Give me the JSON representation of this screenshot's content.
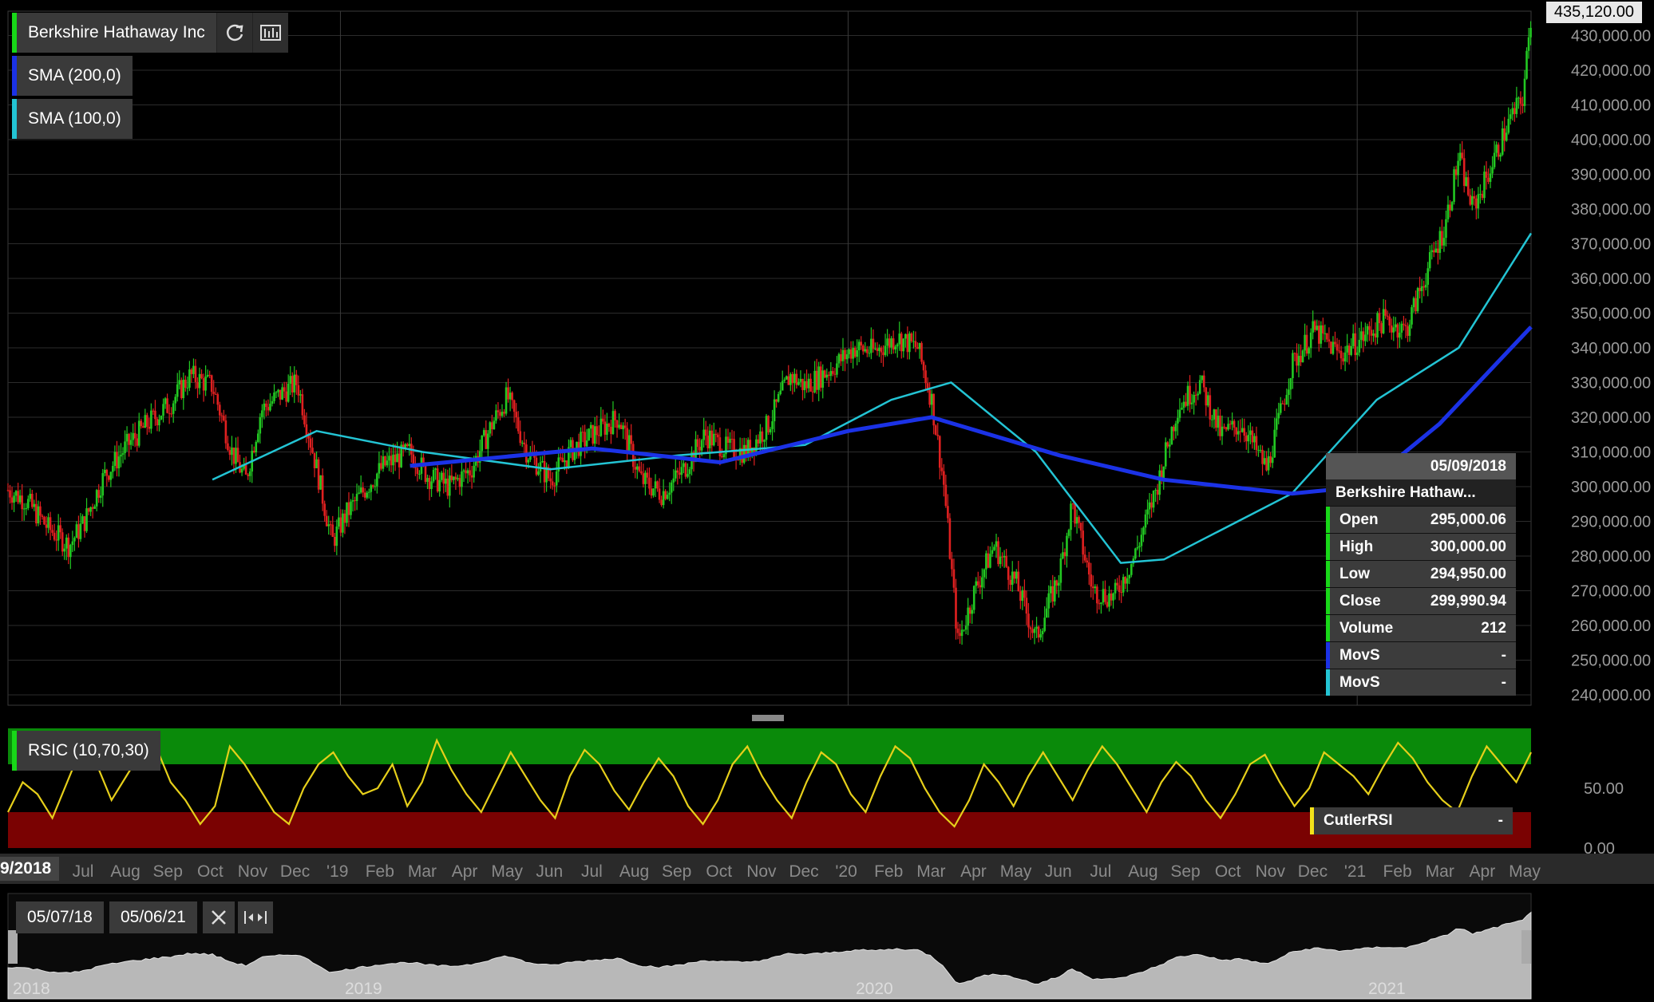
{
  "header": {
    "symbol_label": "Berkshire Hathaway Inc",
    "refresh_icon": "refresh-icon",
    "chart_settings_icon": "chart-settings-icon",
    "current_price_flag": "435,120.00"
  },
  "legend": [
    {
      "label": "SMA (200,0)",
      "color": "#1b32e6"
    },
    {
      "label": "SMA (100,0)",
      "color": "#23c4d4"
    }
  ],
  "colors": {
    "up": "#22c822",
    "down": "#e02020",
    "symbol_marker": "#18d818",
    "sma200": "#1b32e6",
    "sma100": "#23c4d4",
    "rsi_line": "#e6cf1a",
    "rsi_upper_zone": "#0a8a0a",
    "rsi_lower_zone": "#7a0202"
  },
  "tooltip": {
    "date": "05/09/2018",
    "name": "Berkshire Hathaw...",
    "rows": [
      {
        "key": "Open",
        "value": "295,000.06",
        "color": "#18d818"
      },
      {
        "key": "High",
        "value": "300,000.00",
        "color": "#18d818"
      },
      {
        "key": "Low",
        "value": "294,950.00",
        "color": "#18d818"
      },
      {
        "key": "Close",
        "value": "299,990.94",
        "color": "#18d818"
      },
      {
        "key": "Volume",
        "value": "212",
        "color": "#18d818"
      },
      {
        "key": "MovS",
        "value": "-",
        "color": "#1b32e6"
      },
      {
        "key": "MovS",
        "value": "-",
        "color": "#23c4d4"
      }
    ]
  },
  "rsi_panel": {
    "label": "RSIC (10,70,30)",
    "indicator_name": "CutlerRSI",
    "indicator_value": "-",
    "y_ticks": [
      "50.00",
      "0.00"
    ]
  },
  "time_axis": {
    "start_flag": "9/2018",
    "labels": [
      "Jul",
      "Aug",
      "Sep",
      "Oct",
      "Nov",
      "Dec",
      "'19",
      "Feb",
      "Mar",
      "Apr",
      "May",
      "Jun",
      "Jul",
      "Aug",
      "Sep",
      "Oct",
      "Nov",
      "Dec",
      "'20",
      "Feb",
      "Mar",
      "Apr",
      "May",
      "Jun",
      "Jul",
      "Aug",
      "Sep",
      "Oct",
      "Nov",
      "Dec",
      "'21",
      "Feb",
      "Mar",
      "Apr",
      "May"
    ]
  },
  "navigator": {
    "from_date": "05/07/18",
    "to_date": "05/06/21",
    "close_icon": "close-icon",
    "fit-range_icon": "fit-range-icon",
    "year_labels": [
      "2018",
      "2019",
      "2020",
      "2021"
    ]
  },
  "chart_data": {
    "type": "candlestick",
    "title": "Berkshire Hathaway Inc",
    "y_ticks": [
      "430,000.00",
      "420,000.00",
      "410,000.00",
      "400,000.00",
      "390,000.00",
      "380,000.00",
      "370,000.00",
      "360,000.00",
      "350,000.00",
      "340,000.00",
      "330,000.00",
      "320,000.00",
      "310,000.00",
      "300,000.00",
      "290,000.00",
      "280,000.00",
      "270,000.00",
      "260,000.00",
      "250,000.00",
      "240,000.00"
    ],
    "ylim": [
      237000,
      437000
    ],
    "grid": true,
    "close_series": {
      "name": "Berkshire Hathaway Inc",
      "points": [
        [
          "2018-05-07",
          299000
        ],
        [
          "2018-05-20",
          296000
        ],
        [
          "2018-06-05",
          288000
        ],
        [
          "2018-06-20",
          283000
        ],
        [
          "2018-07-01",
          290000
        ],
        [
          "2018-07-15",
          303000
        ],
        [
          "2018-08-01",
          312000
        ],
        [
          "2018-08-15",
          318000
        ],
        [
          "2018-09-01",
          324000
        ],
        [
          "2018-09-15",
          332000
        ],
        [
          "2018-10-01",
          329000
        ],
        [
          "2018-10-15",
          310000
        ],
        [
          "2018-10-25",
          302000
        ],
        [
          "2018-11-05",
          322000
        ],
        [
          "2018-11-20",
          327000
        ],
        [
          "2018-12-01",
          330000
        ],
        [
          "2018-12-15",
          305000
        ],
        [
          "2018-12-26",
          284000
        ],
        [
          "2019-01-05",
          292000
        ],
        [
          "2019-01-20",
          300000
        ],
        [
          "2019-02-01",
          306000
        ],
        [
          "2019-02-20",
          310000
        ],
        [
          "2019-03-05",
          303000
        ],
        [
          "2019-03-20",
          300000
        ],
        [
          "2019-04-05",
          305000
        ],
        [
          "2019-04-20",
          318000
        ],
        [
          "2019-05-01",
          326000
        ],
        [
          "2019-05-15",
          310000
        ],
        [
          "2019-06-01",
          302000
        ],
        [
          "2019-06-15",
          310000
        ],
        [
          "2019-07-01",
          315000
        ],
        [
          "2019-07-20",
          320000
        ],
        [
          "2019-08-05",
          302000
        ],
        [
          "2019-08-20",
          298000
        ],
        [
          "2019-09-05",
          305000
        ],
        [
          "2019-09-20",
          315000
        ],
        [
          "2019-10-05",
          311000
        ],
        [
          "2019-10-20",
          310000
        ],
        [
          "2019-11-05",
          318000
        ],
        [
          "2019-11-20",
          332000
        ],
        [
          "2019-12-01",
          329000
        ],
        [
          "2019-12-20",
          334000
        ],
        [
          "2020-01-05",
          340000
        ],
        [
          "2020-01-20",
          339000
        ],
        [
          "2020-02-05",
          343000
        ],
        [
          "2020-02-20",
          340000
        ],
        [
          "2020-03-01",
          325000
        ],
        [
          "2020-03-10",
          300000
        ],
        [
          "2020-03-20",
          255000
        ],
        [
          "2020-04-01",
          270000
        ],
        [
          "2020-04-15",
          283000
        ],
        [
          "2020-05-01",
          272000
        ],
        [
          "2020-05-15",
          256000
        ],
        [
          "2020-06-01",
          275000
        ],
        [
          "2020-06-10",
          295000
        ],
        [
          "2020-06-25",
          270000
        ],
        [
          "2020-07-10",
          268000
        ],
        [
          "2020-07-25",
          280000
        ],
        [
          "2020-08-10",
          300000
        ],
        [
          "2020-08-25",
          323000
        ],
        [
          "2020-09-10",
          330000
        ],
        [
          "2020-09-25",
          315000
        ],
        [
          "2020-10-10",
          318000
        ],
        [
          "2020-10-28",
          305000
        ],
        [
          "2020-11-05",
          318000
        ],
        [
          "2020-11-15",
          335000
        ],
        [
          "2020-12-01",
          345000
        ],
        [
          "2020-12-20",
          338000
        ],
        [
          "2021-01-05",
          343000
        ],
        [
          "2021-01-20",
          348000
        ],
        [
          "2021-02-05",
          345000
        ],
        [
          "2021-02-20",
          362000
        ],
        [
          "2021-03-05",
          375000
        ],
        [
          "2021-03-15",
          395000
        ],
        [
          "2021-03-25",
          380000
        ],
        [
          "2021-04-05",
          390000
        ],
        [
          "2021-04-20",
          405000
        ],
        [
          "2021-04-30",
          412000
        ],
        [
          "2021-05-06",
          435120
        ]
      ]
    },
    "sma200": {
      "name": "SMA (200,0)",
      "points": [
        [
          "2019-02-20",
          306000
        ],
        [
          "2019-07-01",
          311000
        ],
        [
          "2019-10-01",
          307000
        ],
        [
          "2020-01-01",
          316000
        ],
        [
          "2020-03-01",
          320000
        ],
        [
          "2020-06-01",
          309000
        ],
        [
          "2020-08-15",
          302000
        ],
        [
          "2020-11-15",
          298000
        ],
        [
          "2021-01-05",
          300000
        ],
        [
          "2021-03-01",
          318000
        ],
        [
          "2021-05-06",
          346000
        ]
      ]
    },
    "sma100": {
      "name": "SMA (100,0)",
      "points": [
        [
          "2018-10-01",
          302000
        ],
        [
          "2018-12-15",
          316000
        ],
        [
          "2019-03-01",
          310000
        ],
        [
          "2019-06-01",
          305000
        ],
        [
          "2019-09-01",
          309000
        ],
        [
          "2019-12-01",
          312000
        ],
        [
          "2020-02-01",
          325000
        ],
        [
          "2020-03-15",
          330000
        ],
        [
          "2020-05-15",
          310000
        ],
        [
          "2020-07-15",
          278000
        ],
        [
          "2020-08-15",
          279000
        ],
        [
          "2020-11-15",
          298000
        ],
        [
          "2021-01-15",
          325000
        ],
        [
          "2021-03-15",
          340000
        ],
        [
          "2021-05-06",
          373000
        ]
      ]
    },
    "rsi": {
      "name": "CutlerRSI",
      "ylim": [
        0,
        100
      ],
      "upper_band": 70,
      "lower_band": 30,
      "values": [
        30,
        55,
        45,
        25,
        55,
        85,
        70,
        40,
        60,
        80,
        85,
        55,
        40,
        20,
        35,
        85,
        70,
        50,
        30,
        20,
        50,
        70,
        80,
        60,
        45,
        50,
        70,
        35,
        55,
        90,
        65,
        45,
        30,
        55,
        80,
        60,
        40,
        25,
        60,
        82,
        70,
        48,
        32,
        55,
        75,
        60,
        35,
        20,
        40,
        70,
        85,
        60,
        40,
        25,
        55,
        80,
        70,
        45,
        30,
        60,
        85,
        75,
        50,
        30,
        18,
        40,
        70,
        55,
        35,
        60,
        80,
        60,
        40,
        65,
        85,
        70,
        50,
        30,
        55,
        72,
        60,
        40,
        25,
        45,
        70,
        78,
        55,
        35,
        50,
        80,
        70,
        60,
        45,
        68,
        88,
        75,
        55,
        40,
        30,
        60,
        85,
        70,
        55,
        80
      ]
    }
  }
}
